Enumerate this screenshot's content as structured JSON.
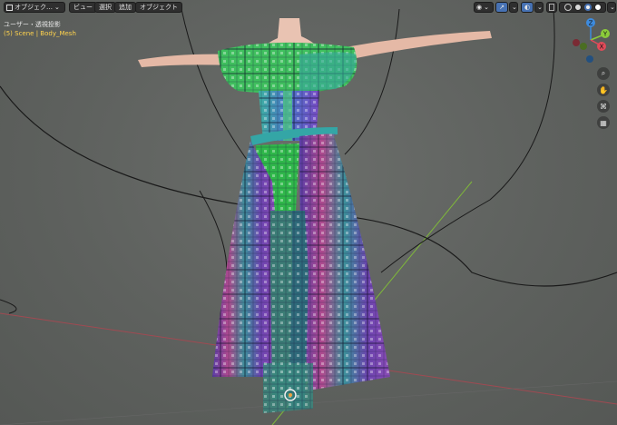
{
  "header": {
    "mode_label": "オブジェク…",
    "menu": {
      "view": "ビュー",
      "select": "選択",
      "add": "追加",
      "object": "オブジェクト"
    }
  },
  "overlay": {
    "view_name": "ユーザー・透視投影",
    "scene_info": "(5) Scene | Body_Mesh"
  },
  "gizmo": {
    "z": "Z",
    "y": "Y",
    "x": "X"
  },
  "icons": {
    "editor_type": "cube-icon",
    "visibility": "eye-icon",
    "gizmo_toggle": "arrow-icon",
    "overlay": "overlay-icon",
    "xray": "xray-icon",
    "shading": [
      "wireframe-icon",
      "solid-icon",
      "material-icon",
      "rendered-icon"
    ],
    "nav": [
      "zoom-icon",
      "hand-icon",
      "camera-icon",
      "grid-icon"
    ]
  },
  "colors": {
    "header_button": "#2f2f2f",
    "active_button": "#4772b3",
    "scene_info_text": "#ffd34d",
    "axis_x": "#e14b59",
    "axis_y": "#8bcc3a",
    "axis_z": "#3d8bde"
  }
}
